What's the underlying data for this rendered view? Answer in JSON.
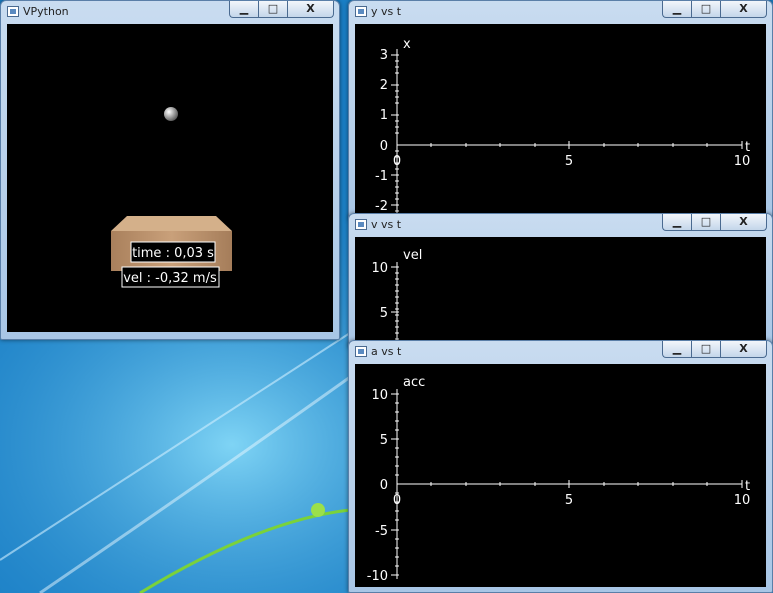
{
  "vpython": {
    "title": "VPython",
    "time_label": "time : 0,03 s",
    "vel_label": "vel : -0,32 m/s"
  },
  "window_buttons": {
    "minimize": "▁",
    "maximize": "□",
    "close": "X"
  },
  "graphs": {
    "x": {
      "title": "y vs t",
      "ylabel": "x",
      "xlabel": "t",
      "yticks": [
        "3",
        "2",
        "1",
        "0",
        "-1",
        "-2"
      ],
      "xticks": [
        "0",
        "5",
        "10"
      ]
    },
    "v": {
      "title": "v vs t",
      "ylabel": "vel",
      "yticks": [
        "10",
        "5"
      ]
    },
    "a": {
      "title": "a vs t",
      "ylabel": "acc",
      "xlabel": "t",
      "yticks": [
        "10",
        "5",
        "0",
        "-5",
        "-10"
      ],
      "xticks": [
        "0",
        "5",
        "10"
      ]
    }
  },
  "colors": {
    "desktop": "#1a7fc6",
    "plot_bg": "#000000",
    "axis": "#ffffff",
    "box": "#b48c68"
  }
}
